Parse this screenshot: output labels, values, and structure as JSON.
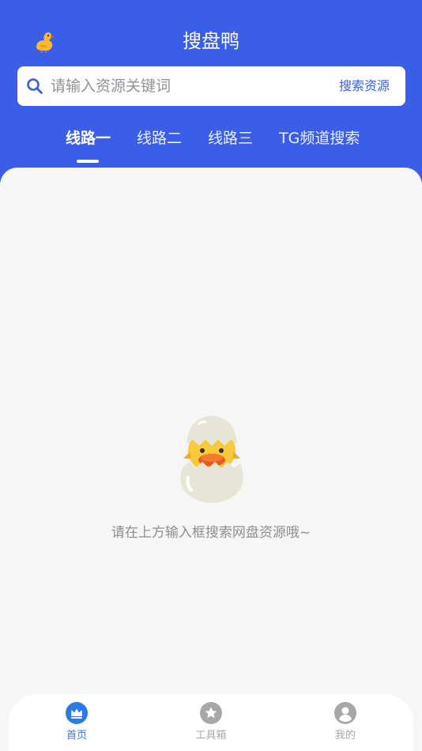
{
  "app": {
    "title": "搜盘鸭"
  },
  "search": {
    "placeholder": "请输入资源关键词",
    "value": "",
    "button_label": "搜索资源"
  },
  "tabs": [
    {
      "label": "线路一",
      "active": true
    },
    {
      "label": "线路二",
      "active": false
    },
    {
      "label": "线路三",
      "active": false
    },
    {
      "label": "TG频道搜索",
      "active": false
    }
  ],
  "empty_state": {
    "message": "请在上方输入框搜索网盘资源哦~",
    "icon": "duck-hatching-egg-icon"
  },
  "bottom_nav": {
    "items": [
      {
        "label": "首页",
        "icon": "crown-icon",
        "active": true
      },
      {
        "label": "工具箱",
        "icon": "star-icon",
        "active": false
      },
      {
        "label": "我的",
        "icon": "user-icon",
        "active": false
      }
    ]
  },
  "colors": {
    "brand_blue": "#3b5ee8",
    "content_bg": "#f6f6f6",
    "nav_active": "#2c7be5",
    "nav_inactive": "#a7a7a7"
  }
}
